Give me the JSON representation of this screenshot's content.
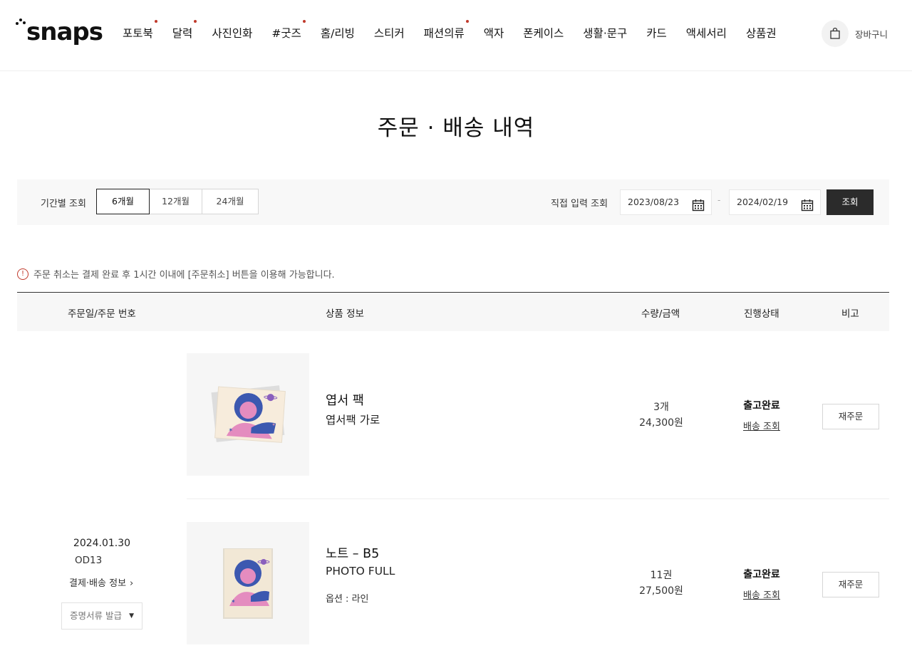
{
  "header": {
    "logo": "snaps",
    "nav": [
      {
        "label": "포토북",
        "dot": true
      },
      {
        "label": "달력",
        "dot": true
      },
      {
        "label": "사진인화",
        "dot": false
      },
      {
        "label": "#굿즈",
        "dot": true
      },
      {
        "label": "홈/리빙",
        "dot": false
      },
      {
        "label": "스티커",
        "dot": false
      },
      {
        "label": "패션의류",
        "dot": true
      },
      {
        "label": "액자",
        "dot": false
      },
      {
        "label": "폰케이스",
        "dot": false
      },
      {
        "label": "생활·문구",
        "dot": false
      },
      {
        "label": "카드",
        "dot": false
      },
      {
        "label": "액세서리",
        "dot": false
      },
      {
        "label": "상품권",
        "dot": false
      }
    ],
    "cart_label": "장바구니"
  },
  "page_title": "주문 · 배송 내역",
  "filter": {
    "period_label": "기간별 조회",
    "periods": [
      "6개월",
      "12개월",
      "24개월"
    ],
    "active_period": "6개월",
    "direct_label": "직접 입력 조회",
    "start_date": "2023/08/23",
    "end_date": "2024/02/19",
    "separator": "-",
    "search_label": "조회"
  },
  "notice": "주문 취소는 결제 완료 후 1시간 이내에 [주문취소] 버튼을 이용해 가능합니다.",
  "table": {
    "headers": {
      "order": "주문일/주문 번호",
      "product": "상품 정보",
      "qty_price": "수량/금액",
      "status": "진행상태",
      "note": "비고"
    },
    "order": {
      "date": "2024.01.30",
      "number": "OD13",
      "pay_info": "결제·배송 정보",
      "cert_label": "증명서류 발급"
    },
    "items": [
      {
        "name": "엽서 팩",
        "sub": "엽서팩 가로",
        "option": "",
        "qty": "3개",
        "price": "24,300원",
        "status": "출고완료",
        "track": "배송 조회",
        "reorder": "재주문"
      },
      {
        "name": "노트 – B5",
        "sub": "PHOTO FULL",
        "option": "옵션 : 라인",
        "qty": "11권",
        "price": "27,500원",
        "status": "출고완료",
        "track": "배송 조회",
        "reorder": "재주문"
      }
    ]
  },
  "colors": {
    "accent_dot": "#c0392b",
    "dark_button": "#2b2b2b",
    "filter_bg": "#f8f8f8"
  }
}
